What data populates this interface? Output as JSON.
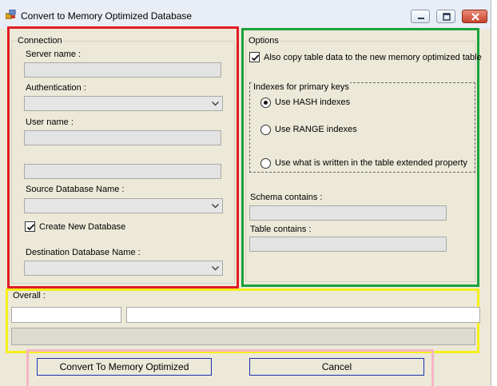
{
  "window": {
    "title": "Convert to Memory Optimized Database"
  },
  "connection": {
    "group_title": "Connection",
    "server_name_label": "Server name :",
    "authentication_label": "Authentication :",
    "user_name_label": "User name  :",
    "source_db_label": "Source Database Name  :",
    "create_new_db_label": "Create New Database",
    "create_new_db_checked": true,
    "destination_db_label": "Destination Database Name  :"
  },
  "options": {
    "group_title": "Options",
    "copy_data_label": "Also copy table data to the new memory optimized table",
    "copy_data_checked": true,
    "indexes_group_title": "Indexes for primary keys",
    "radio_hash_label": "Use HASH indexes",
    "radio_range_label": "Use RANGE indexes",
    "radio_extended_label": "Use what is written in the table extended property",
    "selected_index_option": "Use HASH indexes",
    "schema_label": "Schema contains :",
    "table_label": "Table contains :"
  },
  "overall": {
    "group_title": "Overall :"
  },
  "buttons": {
    "convert_label": "Convert To Memory Optimized",
    "cancel_label": "Cancel"
  },
  "colors": {
    "connection_frame": "#e11c24",
    "options_frame": "#1aa23a",
    "overall_frame": "#f5ef1a",
    "buttons_frame": "#f5b5c5"
  },
  "icons": [
    "app-icon",
    "minimize-icon",
    "maximize-icon",
    "close-icon",
    "chevron-down-icon",
    "checkmark-icon"
  ]
}
